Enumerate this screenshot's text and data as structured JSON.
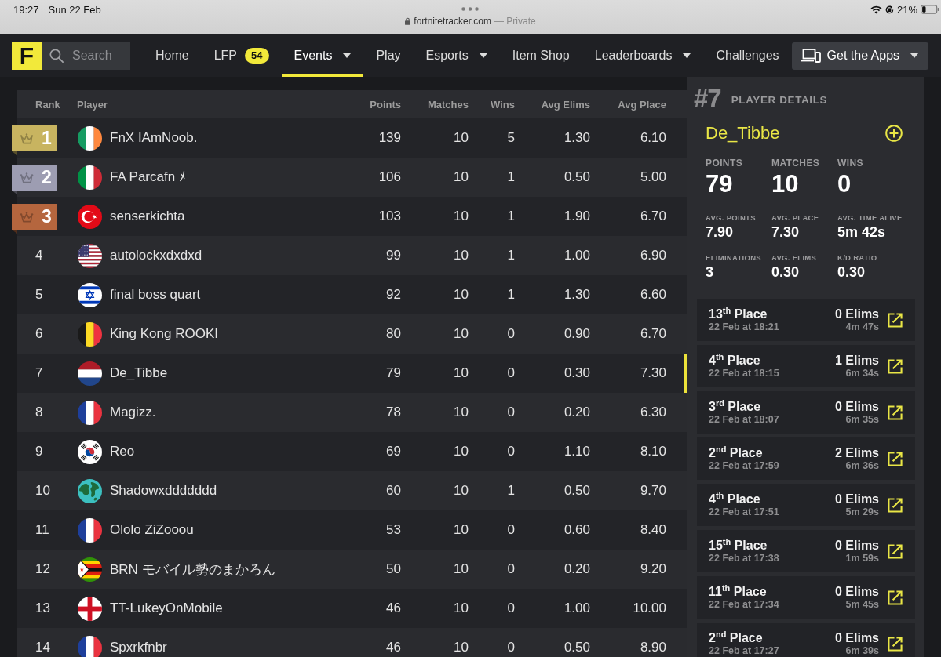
{
  "status_bar": {
    "time": "19:27",
    "date": "Sun 22 Feb",
    "url": "fortnitetracker.com",
    "url_note": "— Private",
    "battery": "21%"
  },
  "nav": {
    "logo": "F",
    "search": {
      "placeholder": "Search"
    },
    "items": [
      {
        "label": "Home",
        "selected": false,
        "dropdown": false
      },
      {
        "label": "LFP",
        "badge": "54",
        "selected": false,
        "dropdown": false
      },
      {
        "label": "Events",
        "selected": true,
        "dropdown": true
      },
      {
        "label": "Play",
        "selected": false,
        "dropdown": false
      },
      {
        "label": "Esports",
        "selected": false,
        "dropdown": true
      },
      {
        "label": "Item Shop",
        "selected": false,
        "dropdown": false
      },
      {
        "label": "Leaderboards",
        "selected": false,
        "dropdown": true
      },
      {
        "label": "Challenges",
        "selected": false,
        "dropdown": false
      }
    ],
    "apps_button": {
      "label": "Get the Apps",
      "dropdown": true
    }
  },
  "table": {
    "columns": [
      "Rank",
      "Player",
      "Points",
      "Matches",
      "Wins",
      "Avg Elims",
      "Avg Place"
    ],
    "rows": [
      {
        "rank": "1",
        "medal": {
          "color": "#c8b460"
        },
        "flag": {
          "kind": "ireland"
        },
        "player": "FnX IAmNoob.",
        "points": "139",
        "matches": "10",
        "wins": "5",
        "avg_elims": "1.30",
        "avg_place": "6.10",
        "selected": false
      },
      {
        "rank": "2",
        "medal": {
          "color": "#9d9db2"
        },
        "flag": {
          "kind": "italy"
        },
        "player": "FA Parcafn ﾒ",
        "points": "106",
        "matches": "10",
        "wins": "1",
        "avg_elims": "0.50",
        "avg_place": "5.00",
        "selected": false
      },
      {
        "rank": "3",
        "medal": {
          "color": "#b5663e"
        },
        "flag": {
          "kind": "turkey"
        },
        "player": "senserkichta",
        "points": "103",
        "matches": "10",
        "wins": "1",
        "avg_elims": "1.90",
        "avg_place": "6.70",
        "selected": false
      },
      {
        "rank": "4",
        "flag": {
          "kind": "usa"
        },
        "player": "autolockxdxdxd",
        "points": "99",
        "matches": "10",
        "wins": "1",
        "avg_elims": "1.00",
        "avg_place": "6.90",
        "selected": false
      },
      {
        "rank": "5",
        "flag": {
          "kind": "israel"
        },
        "player": "final boss quart",
        "points": "92",
        "matches": "10",
        "wins": "1",
        "avg_elims": "1.30",
        "avg_place": "6.60",
        "selected": false
      },
      {
        "rank": "6",
        "flag": {
          "kind": "belgium"
        },
        "player": "King Kong ROOKI",
        "points": "80",
        "matches": "10",
        "wins": "0",
        "avg_elims": "0.90",
        "avg_place": "6.70",
        "selected": false
      },
      {
        "rank": "7",
        "flag": {
          "kind": "netherlands"
        },
        "player": "De_Tibbe",
        "points": "79",
        "matches": "10",
        "wins": "0",
        "avg_elims": "0.30",
        "avg_place": "7.30",
        "selected": true
      },
      {
        "rank": "8",
        "flag": {
          "kind": "france"
        },
        "player": "Magizz.",
        "points": "78",
        "matches": "10",
        "wins": "0",
        "avg_elims": "0.20",
        "avg_place": "6.30",
        "selected": false
      },
      {
        "rank": "9",
        "flag": {
          "kind": "south-korea"
        },
        "player": "Reo",
        "points": "69",
        "matches": "10",
        "wins": "0",
        "avg_elims": "1.10",
        "avg_place": "8.10",
        "selected": false
      },
      {
        "rank": "10",
        "flag": {
          "kind": "globe"
        },
        "player": "Shadowxddddddd",
        "points": "60",
        "matches": "10",
        "wins": "1",
        "avg_elims": "0.50",
        "avg_place": "9.70",
        "selected": false
      },
      {
        "rank": "11",
        "flag": {
          "kind": "france"
        },
        "player": "Ololo ZiZooou",
        "points": "53",
        "matches": "10",
        "wins": "0",
        "avg_elims": "0.60",
        "avg_place": "8.40",
        "selected": false
      },
      {
        "rank": "12",
        "flag": {
          "kind": "zimbabwe"
        },
        "player": "BRN モバイル勢のまかろん",
        "points": "50",
        "matches": "10",
        "wins": "0",
        "avg_elims": "0.20",
        "avg_place": "9.20",
        "selected": false
      },
      {
        "rank": "13",
        "flag": {
          "kind": "england"
        },
        "player": "TT-LukeyOnMobile",
        "points": "46",
        "matches": "10",
        "wins": "0",
        "avg_elims": "1.00",
        "avg_place": "10.00",
        "selected": false
      },
      {
        "rank": "14",
        "flag": {
          "kind": "france"
        },
        "player": "Spxrkfnbr",
        "points": "46",
        "matches": "10",
        "wins": "0",
        "avg_elims": "0.50",
        "avg_place": "8.90",
        "selected": false
      }
    ]
  },
  "player_details": {
    "rank": "#7",
    "title": "PLAYER DETAILS",
    "name": "De_Tibbe",
    "stats": [
      {
        "kind": "large",
        "label": "POINTS",
        "value": "79"
      },
      {
        "kind": "large",
        "label": "MATCHES",
        "value": "10"
      },
      {
        "kind": "large",
        "label": "WINS",
        "value": "0"
      },
      {
        "kind": "small",
        "label": "AVG. POINTS",
        "value": "7.90"
      },
      {
        "kind": "small",
        "label": "AVG. PLACE",
        "value": "7.30"
      },
      {
        "kind": "small",
        "label": "AVG. TIME ALIVE",
        "value": "5m 42s"
      },
      {
        "kind": "small",
        "label": "ELIMINATIONS",
        "value": "3"
      },
      {
        "kind": "small",
        "label": "AVG. ELIMS",
        "value": "0.30"
      },
      {
        "kind": "small",
        "label": "K/D RATIO",
        "value": "0.30"
      }
    ],
    "recent_matches": [
      {
        "place": "13$^{th}$ Place",
        "date": "22 Feb at 18:21",
        "elims": "0 Elims",
        "time": "4m 47s"
      },
      {
        "place": "4$^{th}$ Place",
        "date": "22 Feb at 18:15",
        "elims": "1 Elims",
        "time": "6m 34s"
      },
      {
        "place": "3$^{rd}$ Place",
        "date": "22 Feb at 18:07",
        "elims": "0 Elims",
        "time": "6m 35s"
      },
      {
        "place": "2$^{nd}$ Place",
        "date": "22 Feb at 17:59",
        "elims": "2 Elims",
        "time": "6m 36s"
      },
      {
        "place": "4$^{th}$ Place",
        "date": "22 Feb at 17:51",
        "elims": "0 Elims",
        "time": "5m 29s"
      },
      {
        "place": "15$^{th}$ Place",
        "date": "22 Feb at 17:38",
        "elims": "0 Elims",
        "time": "1m 59s"
      },
      {
        "place": "11$^{th}$ Place",
        "date": "22 Feb at 17:34",
        "elims": "0 Elims",
        "time": "5m 45s"
      },
      {
        "place": "2$^{nd}$ Place",
        "date": "22 Feb at 17:27",
        "elims": "0 Elims",
        "time": "6m 39s"
      }
    ]
  }
}
